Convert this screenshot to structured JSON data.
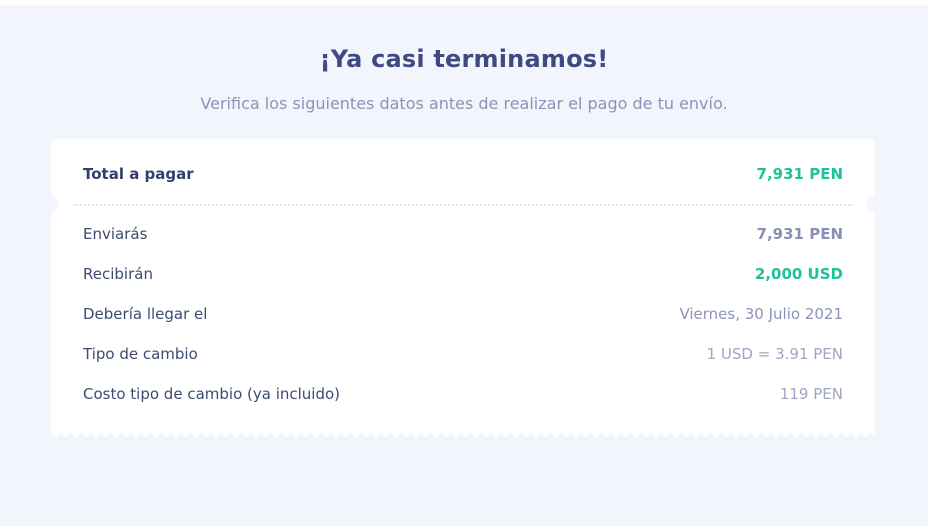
{
  "header": {
    "title": "¡Ya casi terminamos!",
    "subtitle": "Verifica los siguientes datos antes de realizar el pago de tu envío."
  },
  "summary": {
    "total": {
      "label": "Total a pagar",
      "value": "7,931 PEN"
    },
    "rows": [
      {
        "label": "Enviarás",
        "value": "7,931 PEN"
      },
      {
        "label": "Recibirán",
        "value": "2,000 USD"
      },
      {
        "label": "Debería llegar el",
        "value": "Viernes, 30 Julio 2021"
      },
      {
        "label": "Tipo de cambio",
        "value": "1 USD = 3.91 PEN"
      },
      {
        "label": "Costo tipo de cambio (ya incluido)",
        "value": "119 PEN"
      }
    ]
  },
  "colors": {
    "accent": "#1ec29a",
    "heading": "#3e4a81",
    "muted": "#8d93b7",
    "background": "#f3f5fd"
  }
}
